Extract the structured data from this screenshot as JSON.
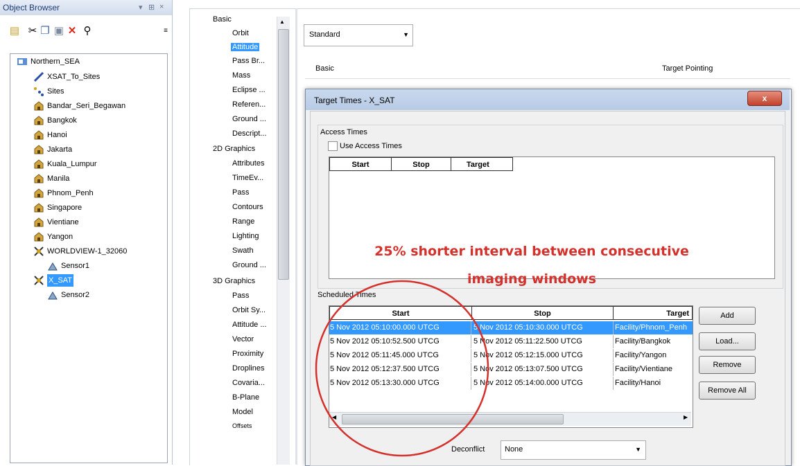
{
  "object_browser": {
    "title": "Object Browser",
    "controls": "▾ ¤ ×",
    "toolbar_overflow": "≡",
    "tree": [
      {
        "label": "Northern_SEA",
        "icon": "scenario-icon",
        "depth": 0
      },
      {
        "label": "XSAT_To_Sites",
        "icon": "chain-icon",
        "depth": 1
      },
      {
        "label": "Sites",
        "icon": "constellation-icon",
        "depth": 1
      },
      {
        "label": "Bandar_Seri_Begawan",
        "icon": "facility-icon",
        "depth": 1
      },
      {
        "label": "Bangkok",
        "icon": "facility-icon",
        "depth": 1
      },
      {
        "label": "Hanoi",
        "icon": "facility-icon",
        "depth": 1
      },
      {
        "label": "Jakarta",
        "icon": "facility-icon",
        "depth": 1
      },
      {
        "label": "Kuala_Lumpur",
        "icon": "facility-icon",
        "depth": 1
      },
      {
        "label": "Manila",
        "icon": "facility-icon",
        "depth": 1
      },
      {
        "label": "Phnom_Penh",
        "icon": "facility-icon",
        "depth": 1
      },
      {
        "label": "Singapore",
        "icon": "facility-icon",
        "depth": 1
      },
      {
        "label": "Vientiane",
        "icon": "facility-icon",
        "depth": 1
      },
      {
        "label": "Yangon",
        "icon": "facility-icon",
        "depth": 1
      },
      {
        "label": "WORLDVIEW-1_32060",
        "icon": "satellite-icon",
        "depth": 1
      },
      {
        "label": "Sensor1",
        "icon": "sensor-icon",
        "depth": 2
      },
      {
        "label": "X_SAT",
        "icon": "satellite-icon",
        "depth": 1,
        "selected": true
      },
      {
        "label": "Sensor2",
        "icon": "sensor-icon",
        "depth": 2
      }
    ]
  },
  "categories": {
    "groups": [
      {
        "label": "Basic",
        "items": [
          "Orbit",
          "Attitude",
          "Pass Br...",
          "Mass",
          "Eclipse ...",
          "Referen...",
          "Ground ...",
          "Descript..."
        ]
      },
      {
        "label": "2D Graphics",
        "items": [
          "Attributes",
          "TimeEv...",
          "Pass",
          "Contours",
          "Range",
          "Lighting",
          "Swath",
          "Ground ..."
        ]
      },
      {
        "label": "3D Graphics",
        "items": [
          "Pass",
          "Orbit Sy...",
          "Attitude ...",
          "Vector",
          "Proximity",
          "Droplines",
          "Covaria...",
          "B-Plane",
          "Model",
          "Offsets"
        ]
      }
    ],
    "selected": "Attitude"
  },
  "property_page": {
    "type_combo_value": "Standard",
    "basic_label": "Basic",
    "target_pointing_label": "Target Pointing"
  },
  "dialog": {
    "title": "Target Times - X_SAT",
    "close_label": "x",
    "access_group_label": "Access Times",
    "use_access_times_label": "Use Access Times",
    "access_columns": [
      "Start",
      "Stop",
      "Target"
    ],
    "scheduled_label": "Scheduled Times",
    "scheduled_columns": [
      "Start",
      "Stop",
      "Target"
    ],
    "scheduled_rows": [
      {
        "start": "5 Nov 2012 05:10:00.000 UTCG",
        "stop": "5 Nov 2012 05:10:30.000 UTCG",
        "target": "Facility/Phnom_Penh",
        "selected": true
      },
      {
        "start": "5 Nov 2012 05:10:52.500 UTCG",
        "stop": "5 Nov 2012 05:11:22.500 UTCG",
        "target": "Facility/Bangkok"
      },
      {
        "start": "5 Nov 2012 05:11:45.000 UTCG",
        "stop": "5 Nov 2012 05:12:15.000 UTCG",
        "target": "Facility/Yangon"
      },
      {
        "start": "5 Nov 2012 05:12:37.500 UTCG",
        "stop": "5 Nov 2012 05:13:07.500 UTCG",
        "target": "Facility/Vientiane"
      },
      {
        "start": "5 Nov 2012 05:13:30.000 UTCG",
        "stop": "5 Nov 2012 05:14:00.000 UTCG",
        "target": "Facility/Hanoi"
      }
    ],
    "buttons": {
      "add": "Add",
      "load": "Load...",
      "remove": "Remove",
      "remove_all": "Remove All"
    },
    "deconflict_label": "Deconflict",
    "deconflict_value": "None"
  },
  "annotation": {
    "line1": "25% shorter interval between consecutive",
    "line2": "imaging windows",
    "color": "#d5312c"
  }
}
